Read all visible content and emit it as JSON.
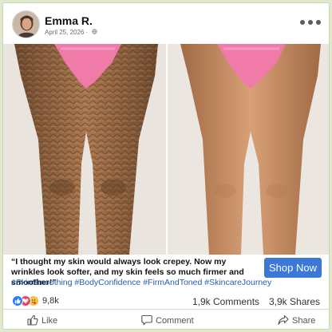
{
  "post": {
    "author": "Emma R.",
    "date": "April 25, 2026 ·",
    "privacy_icon": "globe-icon",
    "caption": "“I thought my skin would always look crepey. Now my wrinkles look softer, and my skin feels so much firmer and smoother!”",
    "hashtags": "#SkinSmoothing #BodyConfidence #FirmAndToned #SkincareJourney",
    "cta_label": "Shop Now"
  },
  "stats": {
    "reaction_icons": [
      "like-icon",
      "love-icon",
      "care-icon"
    ],
    "reaction_count": "9,8k",
    "comments": "1,9k Comments",
    "shares": "3,9k Shares"
  },
  "actions": {
    "like": "Like",
    "comment": "Comment",
    "share": "Share"
  },
  "colors": {
    "accent": "#3b78d8",
    "hashtag": "#2a5bb0",
    "like": "#2d7df6",
    "love": "#f0405a",
    "care": "#f5c33b",
    "frame": "#dfe8cf"
  }
}
